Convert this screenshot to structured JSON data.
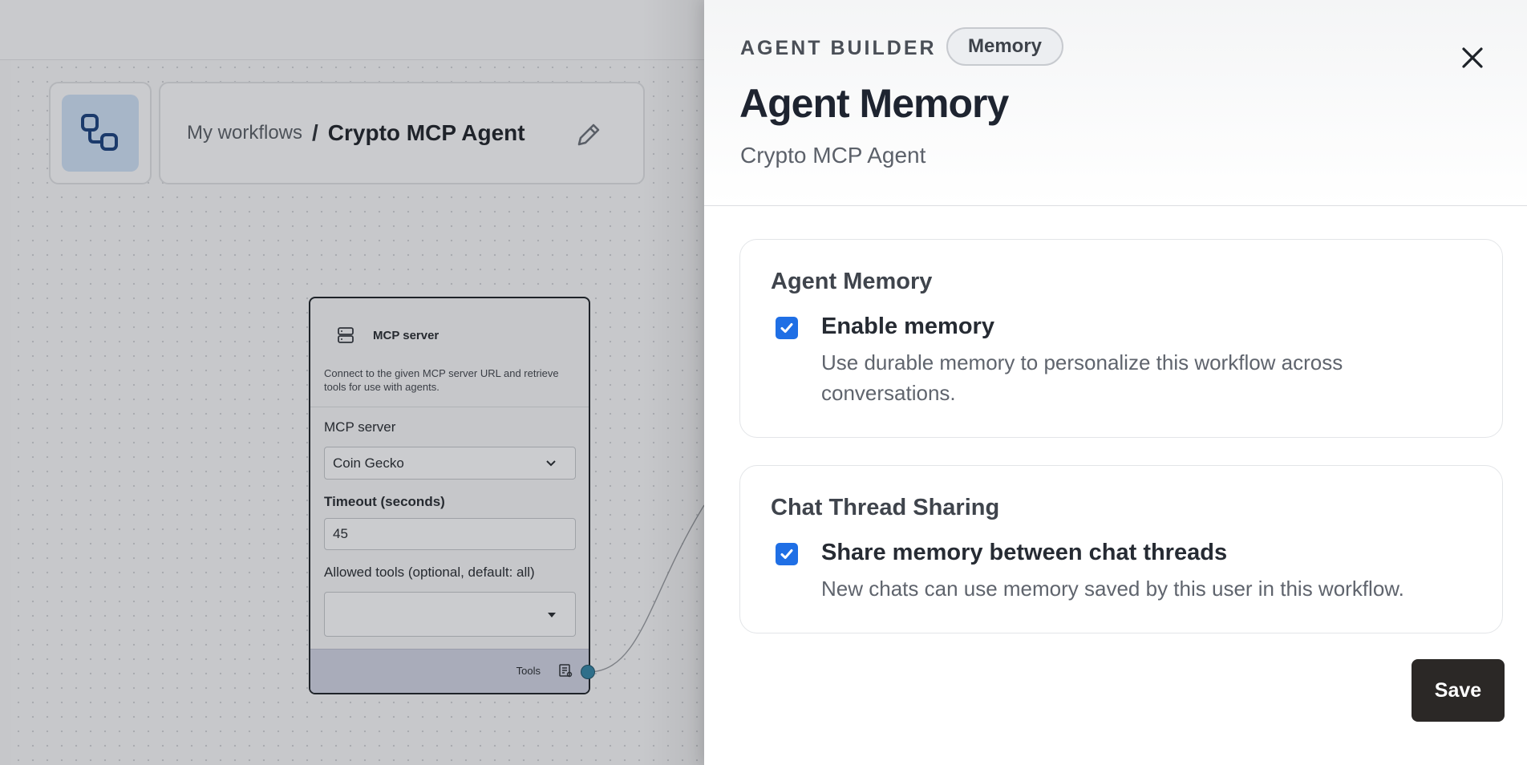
{
  "breadcrumb": {
    "parent": "My workflows",
    "separator": "/",
    "current": "Crypto MCP Agent"
  },
  "node": {
    "title": "MCP server",
    "description": "Connect to the given MCP server URL and retrieve tools for use with agents.",
    "server_label": "MCP server",
    "server_value": "Coin Gecko",
    "timeout_label": "Timeout (seconds)",
    "timeout_value": "45",
    "allowed_tools_label": "Allowed tools (optional, default: all)",
    "allowed_tools_value": "",
    "footer_label": "Tools"
  },
  "drawer": {
    "eyebrow": "AGENT BUILDER",
    "pill": "Memory",
    "title": "Agent Memory",
    "subtitle": "Crypto MCP Agent",
    "sections": [
      {
        "heading": "Agent Memory",
        "option_title": "Enable memory",
        "option_desc": "Use durable memory to personalize this workflow across conversations.",
        "checked": true
      },
      {
        "heading": "Chat Thread Sharing",
        "option_title": "Share memory between chat threads",
        "option_desc": "New chats can use memory saved by this user in this workflow.",
        "checked": true
      }
    ],
    "save_label": "Save"
  },
  "colors": {
    "accent_checkbox": "#1f6fe5",
    "save_button": "#2b2826",
    "title_text": "#1e2430",
    "port": "#2f6f8a"
  },
  "icons": {
    "logo": "workflow-nodes-icon",
    "edit": "pencil-icon",
    "node": "server-icon",
    "dropdown": "chevron-down-icon",
    "tools": "tools-list-icon",
    "close": "close-icon",
    "check": "checkmark-icon"
  }
}
